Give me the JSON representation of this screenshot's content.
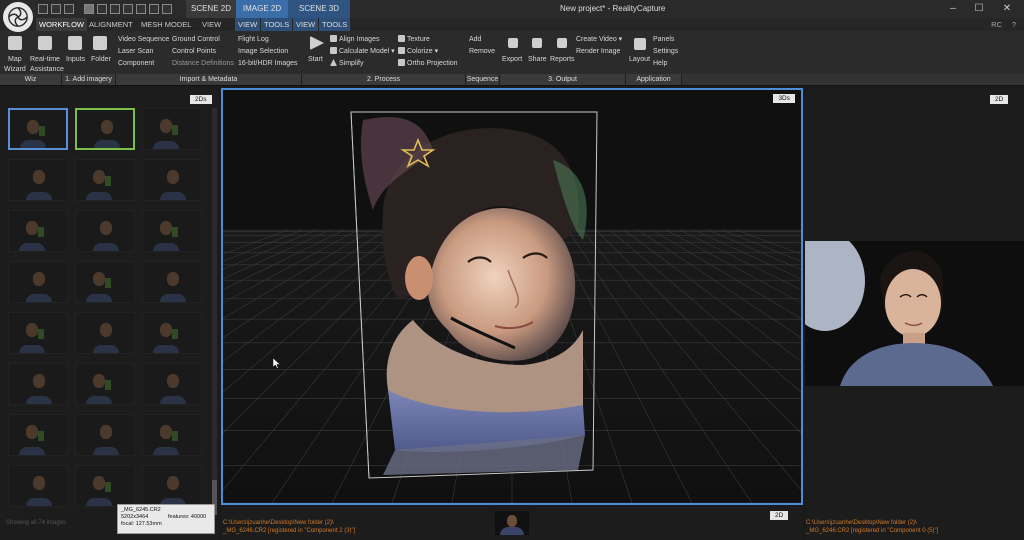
{
  "titlebar": {
    "tabs": [
      {
        "label": "SCENE 2D"
      },
      {
        "label": "IMAGE 2D"
      },
      {
        "label": "SCENE 3D"
      }
    ],
    "window_title": "New project* - RealityCapture",
    "minimize": "–",
    "maximize": "☐",
    "close": "✕"
  },
  "menubar": {
    "items": [
      "WORKFLOW",
      "ALIGNMENT",
      "MESH MODEL",
      "VIEW"
    ],
    "blue_items": [
      "VIEW",
      "TOOLS",
      "VIEW",
      "TOOLS"
    ],
    "rc_label": "RC",
    "help_label": "?"
  },
  "ribbon": {
    "wiz": {
      "map": "Map",
      "realtime": "Real-time",
      "wizard": "Wizard",
      "assistance": "Assistance"
    },
    "add_imagery": {
      "inputs": "Inputs",
      "folder": "Folder"
    },
    "import_metadata": {
      "col1": [
        "Video Sequence",
        "Laser Scan",
        "Component"
      ],
      "col2": [
        "Ground Control",
        "Control Points",
        "Distance Definitions"
      ],
      "col3": [
        "Flight Log",
        "Image Selection",
        "16-bit/HDR Images"
      ]
    },
    "process": {
      "start": "Start",
      "col1": [
        "Align Images",
        "Calculate Model",
        "Simplify"
      ],
      "col2": [
        "Texture",
        "Colorize",
        "Ortho Projection"
      ]
    },
    "sequence": [
      "Add",
      "Remove"
    ],
    "output": {
      "export": "Export",
      "share": "Share",
      "reports": "Reports",
      "col": [
        "Create Video",
        "Render Image"
      ]
    },
    "application": {
      "layout": "Layout",
      "col": [
        "Panels",
        "Settings",
        "Help"
      ]
    },
    "sections": {
      "wiz": "Wiz",
      "add_imagery": "1. Add imagery",
      "import_metadata": "Import & Metadata",
      "process": "2. Process",
      "sequence": "Sequence",
      "output": "3. Output",
      "application": "Application"
    }
  },
  "left_panel": {
    "badge": "2Ds",
    "footer": "Showing all 74 images",
    "tooltip": {
      "filename": "_MG_6245.CR2",
      "size": "5202x3464",
      "features": "features: 40000",
      "focal": "focal: 127.53mm"
    }
  },
  "center_panel": {
    "badge": "3Ds"
  },
  "bottom_bar": {
    "path_line1": "C:\\Users\\jzuanhe\\Desktop\\New folder (2)\\",
    "path_line2": "_MG_6246.CR2 [registered in \"Component 2 (3)\"]",
    "badge": "2D"
  },
  "right_panel": {
    "badge": "2D",
    "path_line1": "C:\\Users\\jzuanhe\\Desktop\\New folder (2)\\",
    "path_line2": "_MG_6246.CR2 [registered in \"Component 0 (5)\"]"
  }
}
